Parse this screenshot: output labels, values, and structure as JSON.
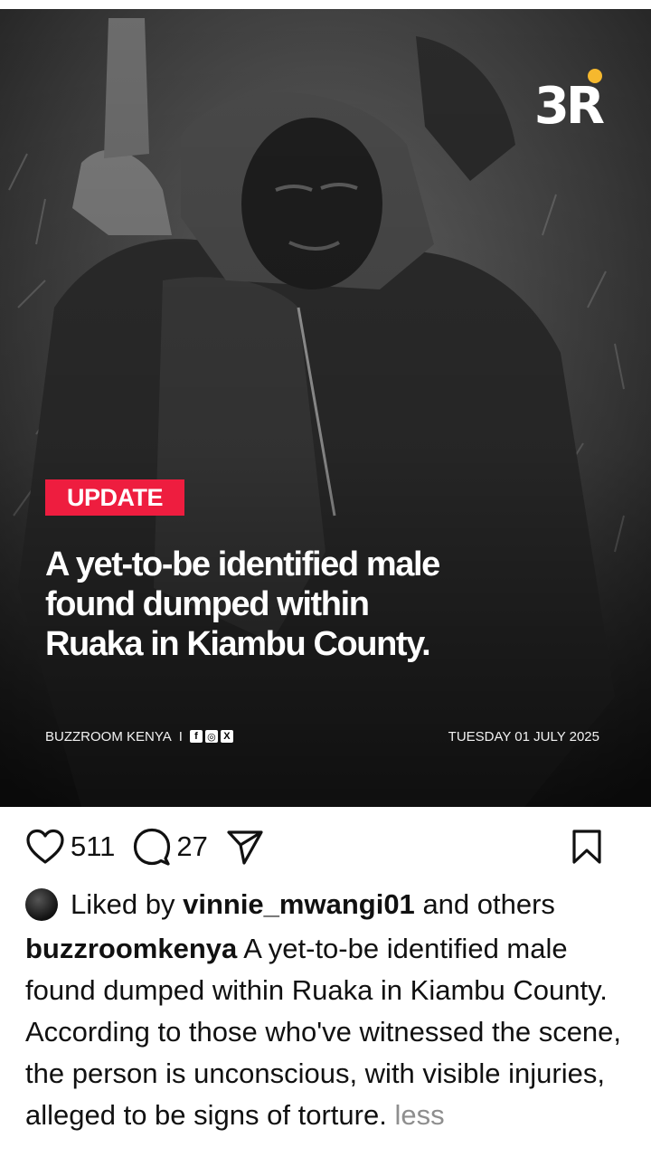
{
  "post": {
    "logo_text": "3R",
    "tag": "UPDATE",
    "headline": "A yet-to-be identified male found dumped within Ruaka in Kiambu County.",
    "source": "BUZZROOM KENYA",
    "separator": "I",
    "social_icons": [
      "f",
      "◎",
      "X"
    ],
    "date": "TUESDAY 01 JULY 2025",
    "colors": {
      "tag": "#ee1d3f",
      "logo_dot": "#f5b82e"
    }
  },
  "actions": {
    "likes_count": "511",
    "comments_count": "27"
  },
  "likes": {
    "prefix": "Liked by",
    "user": "vinnie_mwangi01",
    "suffix": "and others"
  },
  "caption": {
    "username": "buzzroomkenya",
    "text": "A yet-to-be identified male found dumped within Ruaka in Kiambu County. According to those who've witnessed the scene, the person is unconscious, with visible injuries, alleged to be signs of torture.",
    "toggle": "less"
  }
}
